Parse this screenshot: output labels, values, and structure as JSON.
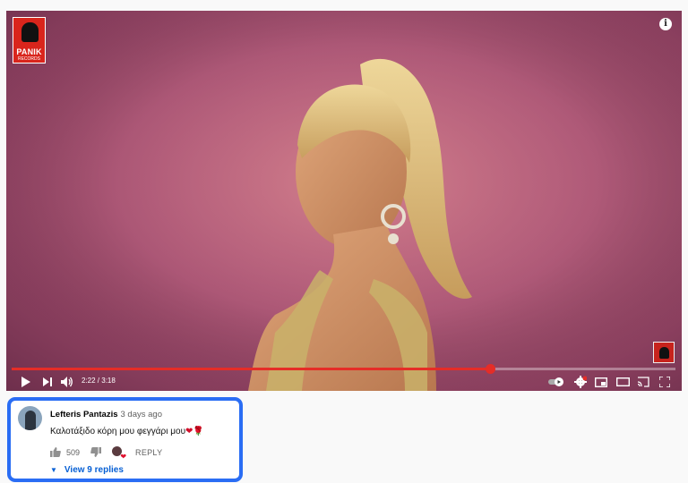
{
  "player": {
    "channel_logo": {
      "name": "PANIK",
      "subtitle": "RECORDS"
    },
    "time_display": "2:22 / 3:18",
    "progress_fraction": 0.72,
    "icons": {
      "play": "play-icon",
      "next": "next-icon",
      "volume": "volume-icon",
      "autoplay": "autoplay-toggle-icon",
      "settings": "settings-gear-icon",
      "miniplayer": "miniplayer-icon",
      "theater": "theater-mode-icon",
      "cast": "cast-icon",
      "fullscreen": "fullscreen-icon",
      "info": "info-icon"
    },
    "accent_color": "#e52d27"
  },
  "comment": {
    "author": "Lefteris Pantazis",
    "date": "3 days ago",
    "text": "Καλοτάξιδο κόρη μου φεγγάρι μου",
    "emoji": "❤🌹",
    "likes": "509",
    "reply_label": "REPLY",
    "view_replies_label": "View 9 replies",
    "highlight_color": "#2a6df4",
    "link_color": "#065fd4"
  }
}
